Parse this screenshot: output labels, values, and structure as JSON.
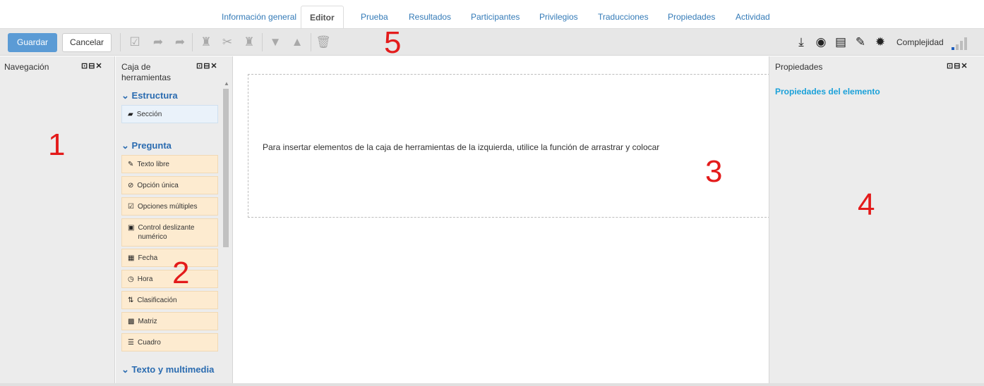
{
  "tabs": [
    {
      "label": "Información general"
    },
    {
      "label": "Editor"
    },
    {
      "label": "Prueba"
    },
    {
      "label": "Resultados"
    },
    {
      "label": "Participantes"
    },
    {
      "label": "Privilegios"
    },
    {
      "label": "Traducciones"
    },
    {
      "label": "Propiedades"
    },
    {
      "label": "Actividad"
    }
  ],
  "active_tab": "Editor",
  "toolbar": {
    "save_label": "Guardar",
    "cancel_label": "Cancelar",
    "complexity_label": "Complejidad",
    "left_icons": [
      "validate-icon",
      "undo-icon",
      "redo-icon",
      "paste-icon",
      "cut-icon",
      "clipboard-icon",
      "move-down-icon",
      "move-up-icon",
      "delete-icon"
    ],
    "right_icons": [
      "download-icon",
      "preview-icon",
      "list-icon",
      "wrench-icon",
      "settings-icon"
    ]
  },
  "navigation": {
    "title": "Navegación"
  },
  "toolbox": {
    "title": "Caja de herramientas",
    "sections": [
      {
        "title": "Estructura",
        "items": [
          {
            "label": "Sección",
            "icon": "folder-icon"
          }
        ]
      },
      {
        "title": "Pregunta",
        "items": [
          {
            "label": "Texto libre",
            "icon": "pencil-icon"
          },
          {
            "label": "Opción única",
            "icon": "radio-icon"
          },
          {
            "label": "Opciones múltiples",
            "icon": "checkbox-icon"
          },
          {
            "label": "Control deslizante numérico",
            "icon": "slider-icon"
          },
          {
            "label": "Fecha",
            "icon": "calendar-icon"
          },
          {
            "label": "Hora",
            "icon": "clock-icon"
          },
          {
            "label": "Clasificación",
            "icon": "sort-icon"
          },
          {
            "label": "Matriz",
            "icon": "matrix-icon"
          },
          {
            "label": "Cuadro",
            "icon": "table-icon"
          }
        ]
      },
      {
        "title": "Texto y multimedia",
        "items": []
      }
    ]
  },
  "editor": {
    "placeholder_text": "Para insertar elementos de la caja de herramientas de la izquierda, utilice la función de arrastrar y colocar"
  },
  "properties": {
    "title": "Propiedades",
    "heading": "Propiedades del elemento"
  },
  "annotations": [
    "1",
    "2",
    "3",
    "4",
    "5"
  ],
  "colors": {
    "save_button": "#5b9bd5",
    "section_heading": "#2a6bb0",
    "properties_heading": "#1ba1d9",
    "tool_item_bg": "#fdebd0",
    "annotation": "#e31b1b",
    "complexity_bars": [
      "#1f5fbf",
      "#bdbdbd",
      "#bdbdbd",
      "#bdbdbd"
    ]
  }
}
